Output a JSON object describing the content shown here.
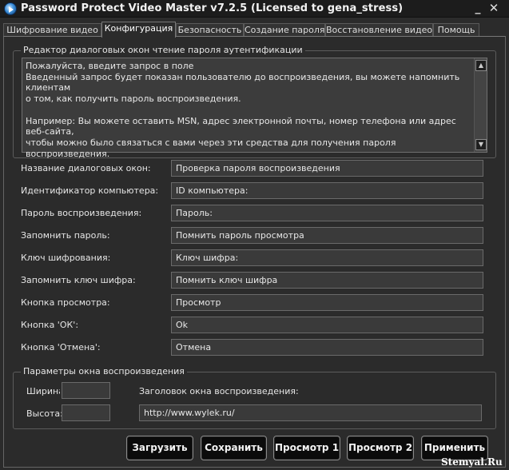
{
  "window": {
    "title": "Password Protect Video Master v7.2.5 (Licensed to gena_stress)",
    "app_icon": "play-disc-icon",
    "min_icon": "minimize-icon",
    "close_icon": "close-icon",
    "min_glyph": "_",
    "close_glyph": "✕"
  },
  "tabs": [
    {
      "label": "Шифрование видео",
      "active": false
    },
    {
      "label": "Конфигурация",
      "active": true
    },
    {
      "label": "Безопасность",
      "active": false
    },
    {
      "label": "Создание пароля",
      "active": false
    },
    {
      "label": "Восстановление видео",
      "active": false
    },
    {
      "label": "Помощь",
      "active": false
    }
  ],
  "editor": {
    "group_title": "Редактор диалоговых окон чтение пароля аутентификации",
    "lines": [
      "Пожалуйста, введите запрос в поле",
      "Введенный запрос будет показан пользователю до воспроизведения, вы можете напомнить клиентам",
      "о том, как получить пароль воспроизведения.",
      "Например: Вы можете оставить MSN, адрес электронной почты, номер телефона или адрес веб-сайта,",
      "чтобы можно было связаться с вами через эти средства для получения пароля воспроизведения."
    ],
    "scroll_up_icon": "scroll-up-arrow-icon",
    "scroll_down_icon": "scroll-down-arrow-icon",
    "up_glyph": "▲",
    "down_glyph": "▼"
  },
  "fields": [
    {
      "label": "Название диалоговых окон:",
      "value": "Проверка пароля воспроизведения"
    },
    {
      "label": "Идентификатор компьютера:",
      "value": "ID компьютера:"
    },
    {
      "label": "Пароль воспроизведения:",
      "value": "Пароль:"
    },
    {
      "label": "Запомнить пароль:",
      "value": "Помнить пароль просмотра"
    },
    {
      "label": "Ключ шифрования:",
      "value": "Ключ шифра:"
    },
    {
      "label": "Запомнить ключ шифра:",
      "value": "Помнить ключ шифра"
    },
    {
      "label": "Кнопка просмотра:",
      "value": "Просмотр"
    },
    {
      "label": "Кнопка 'ОК':",
      "value": "Ok"
    },
    {
      "label": "Кнопка 'Отмена':",
      "value": "Отмена"
    }
  ],
  "playback": {
    "group_title": "Параметры окна воспроизведения",
    "width_label": "Ширина:",
    "width_value": "",
    "height_label": "Высота:",
    "height_value": "",
    "window_title_label": "Заголовок окна воспроизведения:",
    "window_title_value": "http://www.wylek.ru/"
  },
  "buttons": {
    "load": "Загрузить",
    "save": "Сохранить",
    "preview1": "Просмотр 1",
    "preview2": "Просмотр 2",
    "apply": "Применить"
  },
  "watermark": "Stemyal.Ru"
}
